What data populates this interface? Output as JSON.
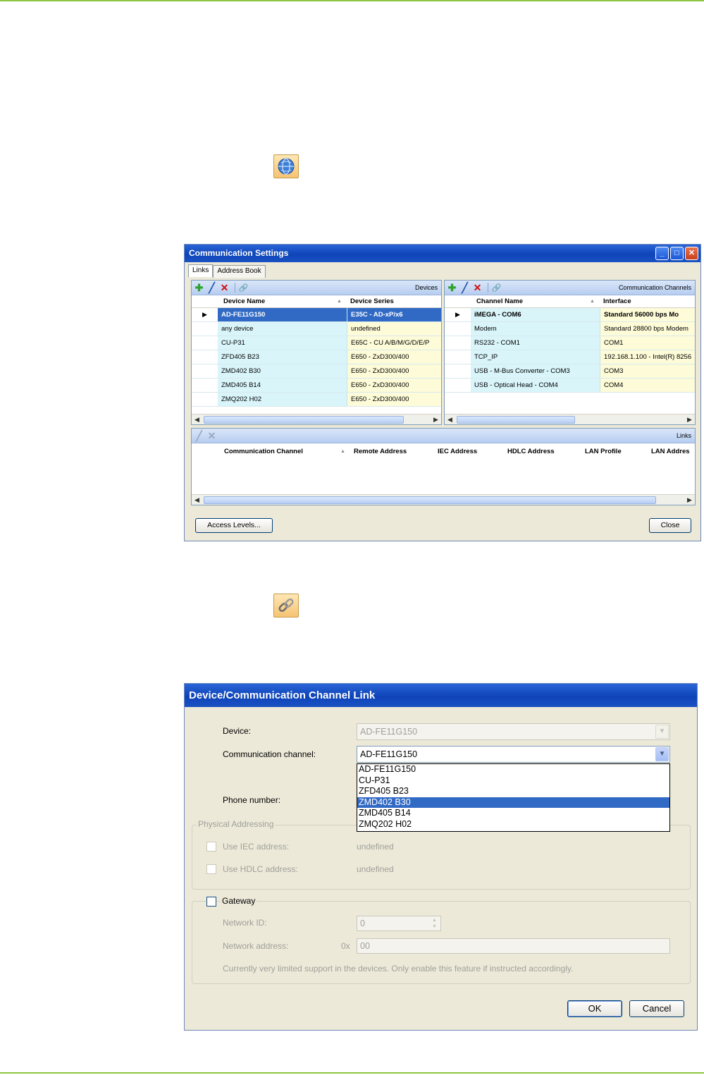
{
  "comm_settings": {
    "title": "Communication Settings",
    "tabs": [
      "Links",
      "Address Book"
    ],
    "devices": {
      "title": "Devices",
      "col_name": "Device Name",
      "col_series": "Device Series",
      "rows": [
        {
          "name": "AD-FE11G150",
          "series": "E35C - AD-xP/x6"
        },
        {
          "name": "any device",
          "series": "undefined"
        },
        {
          "name": "CU-P31",
          "series": "E65C - CU A/B/M/G/D/E/P"
        },
        {
          "name": "ZFD405 B23",
          "series": "E650 - ZxD300/400"
        },
        {
          "name": "ZMD402 B30",
          "series": "E650 - ZxD300/400"
        },
        {
          "name": "ZMD405 B14",
          "series": "E650 - ZxD300/400"
        },
        {
          "name": "ZMQ202 H02",
          "series": "E650 - ZxD300/400"
        }
      ]
    },
    "channels": {
      "title": "Communication Channels",
      "col_name": "Channel Name",
      "col_iface": "Interface",
      "rows": [
        {
          "name": "iMEGA - COM6",
          "iface": "Standard 56000 bps Mo"
        },
        {
          "name": "Modem",
          "iface": "Standard 28800 bps Modem"
        },
        {
          "name": "RS232 - COM1",
          "iface": "COM1"
        },
        {
          "name": "TCP_IP",
          "iface": "192.168.1.100 - Intel(R) 8256"
        },
        {
          "name": "USB - M-Bus Converter - COM3",
          "iface": "COM3"
        },
        {
          "name": "USB - Optical Head - COM4",
          "iface": "COM4"
        }
      ]
    },
    "links": {
      "title": "Links",
      "cols": [
        "Communication Channel",
        "Remote Address",
        "IEC Address",
        "HDLC Address",
        "LAN Profile",
        "LAN Addres"
      ]
    },
    "access_levels_btn": "Access Levels...",
    "close_btn": "Close"
  },
  "link_dialog": {
    "title": "Device/Communication Channel Link",
    "device_label": "Device:",
    "device_value": "AD-FE11G150",
    "channel_label": "Communication channel:",
    "channel_value": "AD-FE11G150",
    "channel_options": [
      "AD-FE11G150",
      "CU-P31",
      "ZFD405 B23",
      "ZMD402 B30",
      "ZMD405 B14",
      "ZMQ202 H02"
    ],
    "phone_label": "Phone number:",
    "physical_group": "Physical Addressing",
    "iec_label": "Use IEC address:",
    "iec_value": "undefined",
    "hdlc_label": "Use HDLC address:",
    "hdlc_value": "undefined",
    "gateway_label": "Gateway",
    "network_id_label": "Network ID:",
    "network_id_value": "0",
    "network_addr_label": "Network address:",
    "network_addr_prefix": "0x",
    "network_addr_value": "00",
    "note": "Currently very limited support in the devices. Only enable this feature if instructed accordingly.",
    "ok_btn": "OK",
    "cancel_btn": "Cancel"
  }
}
